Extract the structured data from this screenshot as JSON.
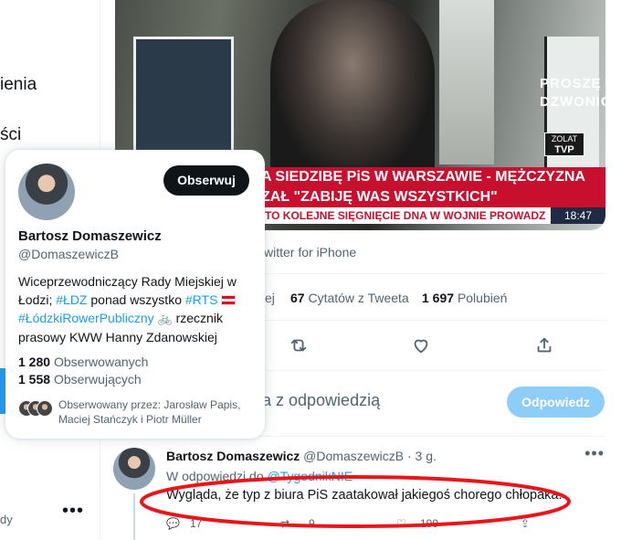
{
  "nav": {
    "item1": "ienia",
    "item2": "ści",
    "bottom_text": "dy",
    "more_label": "•••"
  },
  "media": {
    "door_sign": "PROSZĘ DZWONIĆ",
    "channel_logo_top": "ZOLAT",
    "channel_logo_bottom": "TVP",
    "headline_line1": "A SIEDZIBĘ PiS W WARSZAWIE - MĘŻCZYZNA",
    "headline_line2": "ZAŁ \"ZABIJĘ WAS WSZYSTKICH\"",
    "ticker": "TO KOLEJNE SIĘGNIĘCIE DNA W WOJNIE PROWADZ",
    "clock": "18:47"
  },
  "tweet": {
    "via": "witter for iPhone",
    "stats_fragment": "ej",
    "quotes_count": "67",
    "quotes_label": "Cytatów z Tweeta",
    "likes_count": "1 697",
    "likes_label": "Polubień",
    "reply_prompt": "a z odpowiedzią",
    "reply_button": "Odpowiedz"
  },
  "reply": {
    "name": "Bartosz Domaszewicz",
    "handle": "@DomaszewiczB",
    "time": "· 3 g.",
    "more_label": "•••",
    "in_reply_prefix": "W odpowiedzi do",
    "in_reply_handle": "@TygodnikNIE",
    "text": "Wygląda, że typ z biura PiS zaatakował jakiegoś chorego chłopaka.",
    "reply_count": "17",
    "retweet_count": "9",
    "like_count": "199"
  },
  "hovercard": {
    "follow_button": "Obserwuj",
    "name": "Bartosz Domaszewicz",
    "handle": "@DomaszewiczB",
    "bio_part1": "Wiceprzewodniczący Rady Miejskiej w Łodzi; ",
    "bio_tag1": "#ŁDZ",
    "bio_part2": " ponad wszystko ",
    "bio_tag2": "#RTS",
    "bio_tag3": "#ŁódzkiRowerPubliczny",
    "bio_part3": " rzecznik prasowy KWW Hanny Zdanowskiej",
    "following_count": "1 280",
    "following_label": "Obserwowanych",
    "followers_count": "1 558",
    "followers_label": "Obserwujących",
    "followed_by": "Obserwowany przez: Jarosław Papis, Maciej Stańczyk i Piotr Müller"
  },
  "colors": {
    "accent": "#1d9bf0",
    "annotation": "#e8161b",
    "news_band": "#c8102e"
  }
}
